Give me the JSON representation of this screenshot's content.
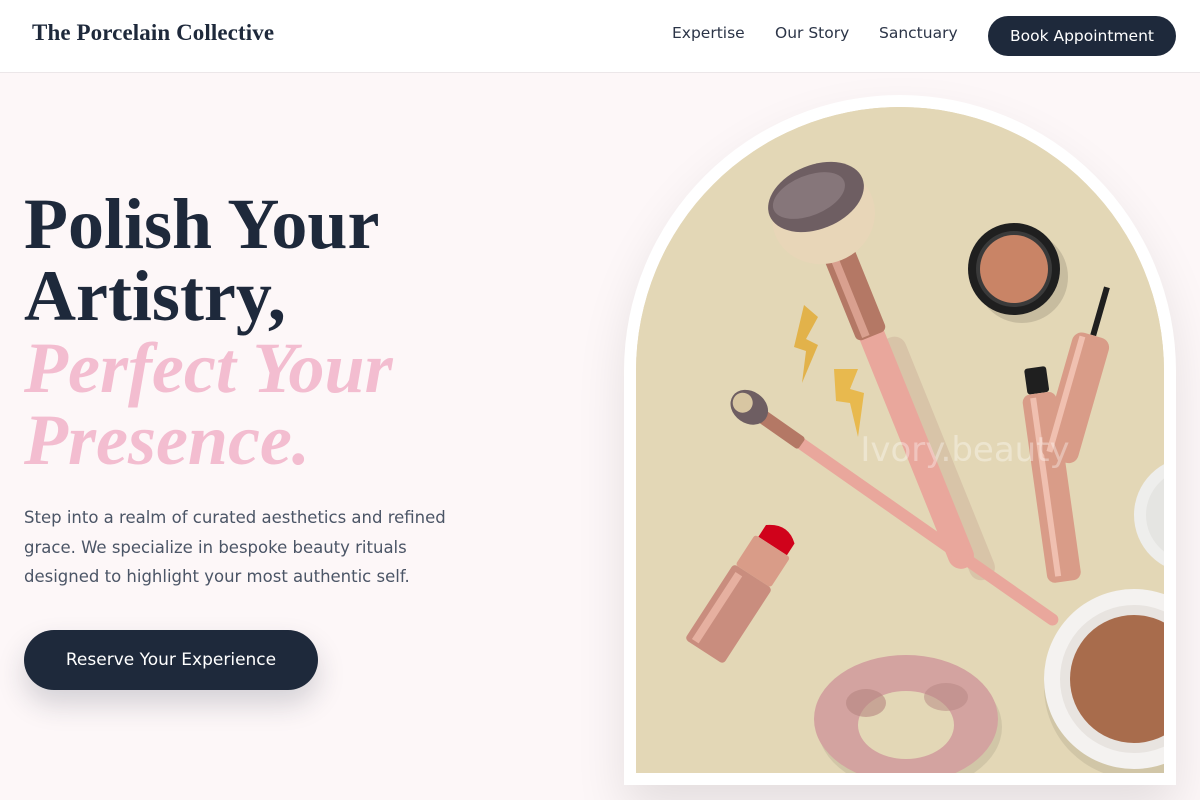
{
  "header": {
    "brand": "The Porcelain Collective",
    "nav": [
      {
        "label": "Expertise"
      },
      {
        "label": "Our Story"
      },
      {
        "label": "Sanctuary"
      }
    ],
    "book_label": "Book Appointment"
  },
  "hero": {
    "headline_line1": "Polish Your",
    "headline_line2": "Artistry,",
    "headline_accent1": "Perfect Your",
    "headline_accent2": "Presence.",
    "lede": "Step into a realm of curated aesthetics and refined grace. We specialize in bespoke beauty rituals designed to highlight your most authentic self.",
    "cta_label": "Reserve Your Experience"
  },
  "image": {
    "watermark": "Ivory.beauty",
    "colors": {
      "background": "#e3d7b6",
      "brush_handle": "#e9a79c",
      "rose_gold": "#c98d7e",
      "lipstick_red": "#d0021b",
      "scrunchie": "#d3a3a0"
    }
  },
  "colors": {
    "navy": "#1e293b",
    "accent_pink": "#f3bdd0",
    "page_bg": "#fdf7f8"
  }
}
